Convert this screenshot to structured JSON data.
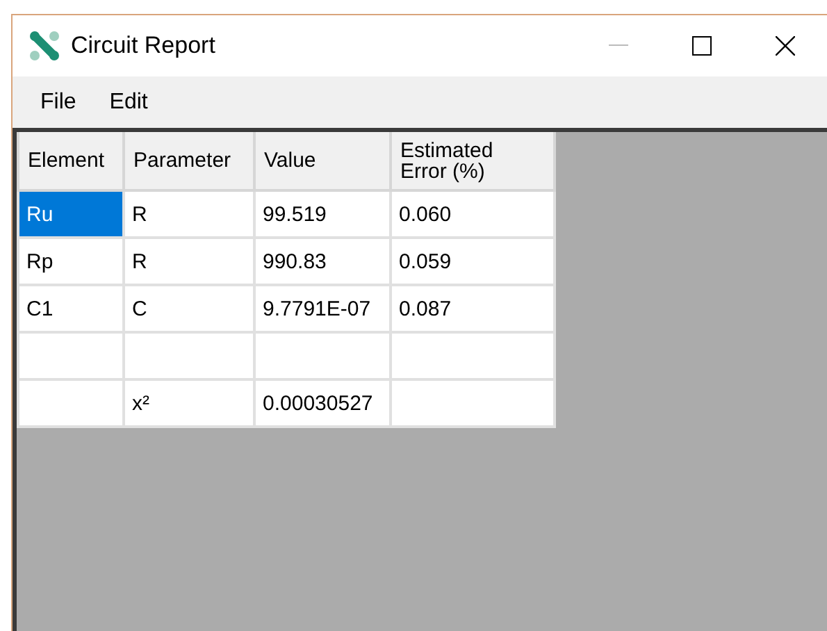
{
  "window": {
    "title": "Circuit Report"
  },
  "menu": [
    {
      "label": "File"
    },
    {
      "label": "Edit"
    }
  ],
  "table": {
    "columns": [
      "Element",
      "Parameter",
      "Value",
      "Estimated Error (%)"
    ],
    "rows": [
      {
        "cells": [
          {
            "text": "Ru",
            "selected": true
          },
          {
            "text": "R",
            "selected": false
          },
          {
            "text": "99.519",
            "selected": false
          },
          {
            "text": "0.060",
            "selected": false
          }
        ]
      },
      {
        "cells": [
          {
            "text": "Rp",
            "selected": false
          },
          {
            "text": "R",
            "selected": false
          },
          {
            "text": "990.83",
            "selected": false
          },
          {
            "text": "0.059",
            "selected": false
          }
        ]
      },
      {
        "cells": [
          {
            "text": "C1",
            "selected": false
          },
          {
            "text": "C",
            "selected": false
          },
          {
            "text": "9.7791E-07",
            "selected": false
          },
          {
            "text": "0.087",
            "selected": false
          }
        ]
      },
      {
        "cells": [
          {
            "selected": false
          },
          {
            "selected": false
          },
          {
            "selected": false
          },
          {
            "selected": false
          }
        ]
      },
      {
        "cells": [
          {
            "selected": false
          },
          {
            "text": "x²",
            "selected": false
          },
          {
            "text": "0.00030527",
            "selected": false
          },
          {
            "selected": false
          }
        ]
      }
    ]
  }
}
